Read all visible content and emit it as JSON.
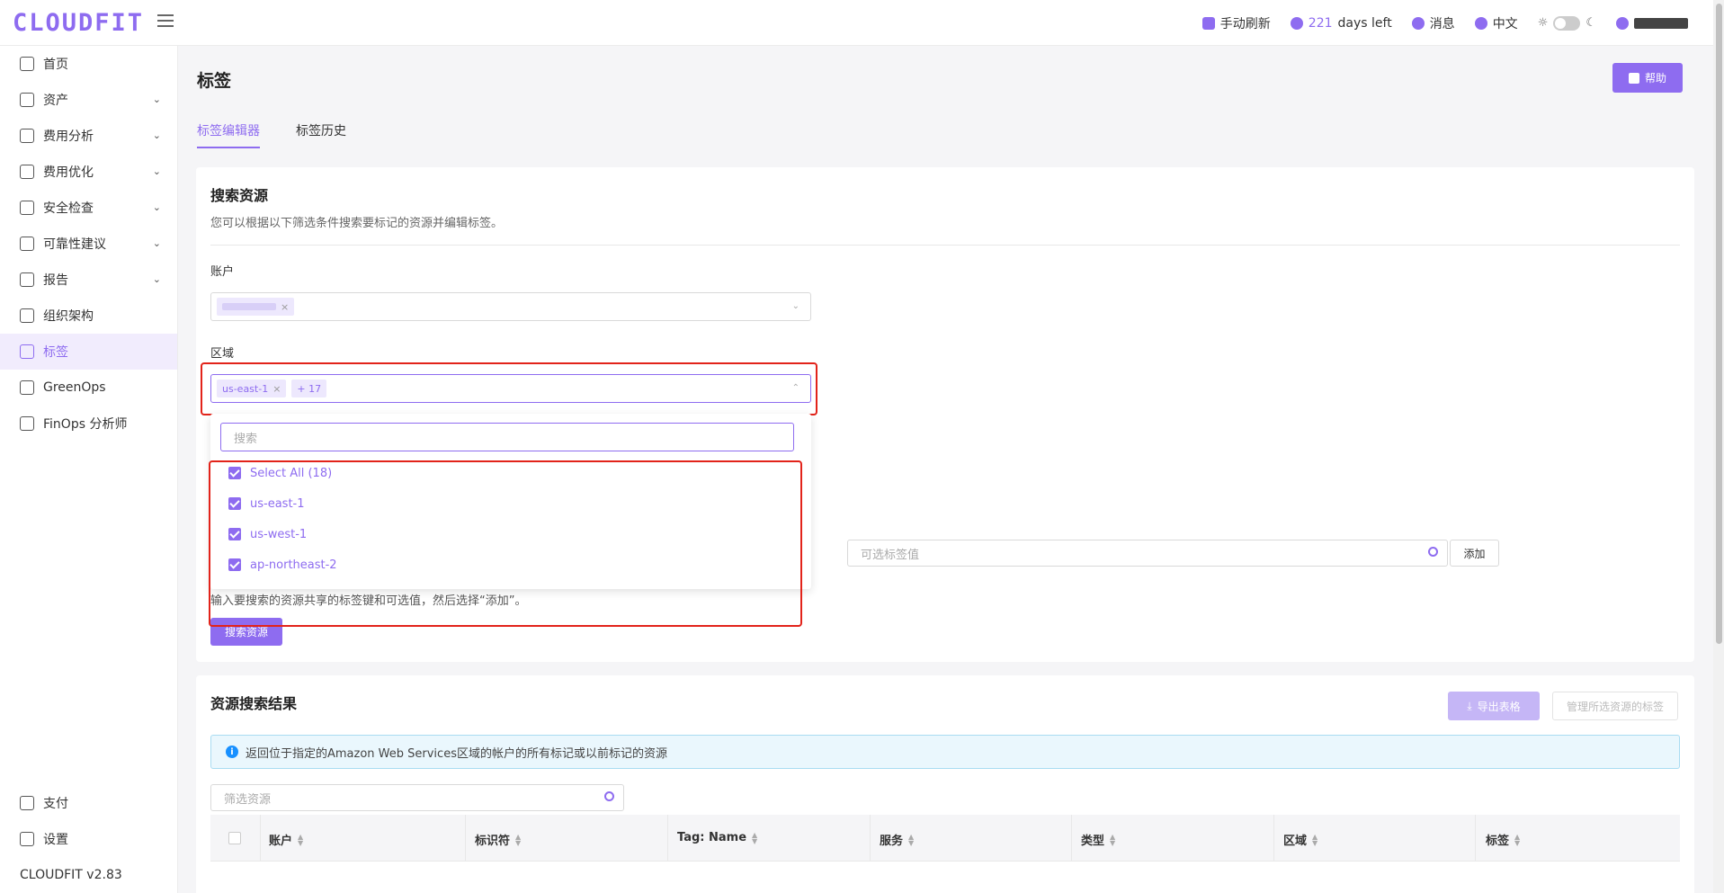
{
  "app": {
    "logo": "CLOUDFIT",
    "version": "CLOUDFIT v2.83"
  },
  "topbar": {
    "refresh": "手动刷新",
    "days_count": "221",
    "days_suffix": "days left",
    "messages": "消息",
    "language": "中文"
  },
  "sidebar": {
    "items": [
      {
        "label": "首页",
        "expandable": false
      },
      {
        "label": "资产",
        "expandable": true
      },
      {
        "label": "费用分析",
        "expandable": true
      },
      {
        "label": "费用优化",
        "expandable": true
      },
      {
        "label": "安全检查",
        "expandable": true
      },
      {
        "label": "可靠性建议",
        "expandable": true
      },
      {
        "label": "报告",
        "expandable": true
      },
      {
        "label": "组织架构",
        "expandable": false
      },
      {
        "label": "标签",
        "expandable": false,
        "active": true
      },
      {
        "label": "GreenOps",
        "expandable": false
      },
      {
        "label": "FinOps 分析师",
        "expandable": false
      }
    ],
    "bottom": [
      {
        "label": "支付"
      },
      {
        "label": "设置"
      }
    ]
  },
  "page": {
    "title": "标签",
    "help": "帮助",
    "tabs": [
      {
        "label": "标签编辑器",
        "active": true
      },
      {
        "label": "标签历史",
        "active": false
      }
    ]
  },
  "search_card": {
    "title": "搜索资源",
    "description": "您可以根据以下筛选条件搜索要标记的资源并编辑标签。",
    "account_label": "账户",
    "region_label": "区域",
    "region_chip": "us-east-1",
    "region_more": "+ 17",
    "dropdown": {
      "search_placeholder": "搜索",
      "options": [
        "Select All (18)",
        "us-east-1",
        "us-west-1",
        "ap-northeast-2"
      ]
    },
    "tag_value_placeholder": "可选标签值",
    "add_button": "添加",
    "hint": "输入要搜索的资源共享的标签键和可选值，然后选择“添加”。",
    "search_button": "搜索资源"
  },
  "results_card": {
    "title": "资源搜索结果",
    "export_button": "导出表格",
    "manage_button": "管理所选资源的标签",
    "info": "返回位于指定的Amazon Web Services区域的帐户的所有标记或以前标记的资源",
    "filter_placeholder": "筛选资源",
    "columns": [
      "账户",
      "标识符",
      "Tag: Name",
      "服务",
      "类型",
      "区域",
      "标签"
    ]
  },
  "colors": {
    "accent": "#8e6cf0",
    "highlight_border": "#e2231a",
    "info_bg": "#eaf7fd"
  }
}
